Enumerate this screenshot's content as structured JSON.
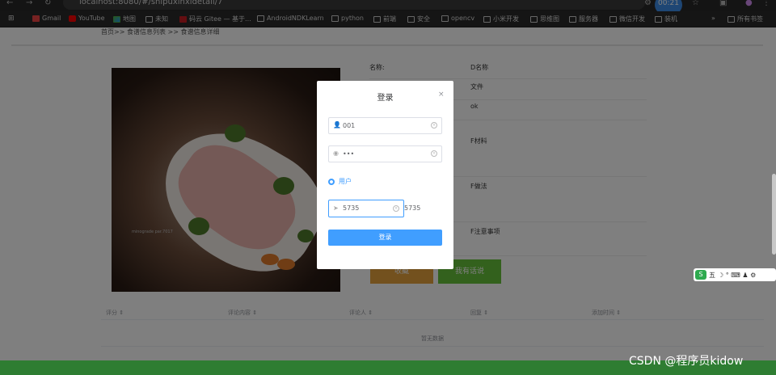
{
  "browser": {
    "url": "localhost:8080/#/shipuxinxidetail/7",
    "timer": "00:21",
    "bookmarks": [
      {
        "label": "Gmail",
        "icon": "gmail-icon"
      },
      {
        "label": "YouTube",
        "icon": "youtube-icon"
      },
      {
        "label": "地图",
        "icon": "maps-icon"
      },
      {
        "label": "未知",
        "icon": "folder-icon"
      },
      {
        "label": "码云 Gitee — 基于...",
        "icon": "gitee-icon"
      },
      {
        "label": "AndroidNDKLearn",
        "icon": "folder-icon"
      },
      {
        "label": "python",
        "icon": "folder-icon"
      },
      {
        "label": "前端",
        "icon": "folder-icon"
      },
      {
        "label": "安全",
        "icon": "folder-icon"
      },
      {
        "label": "opencv",
        "icon": "folder-icon"
      },
      {
        "label": "小米开发",
        "icon": "folder-icon"
      },
      {
        "label": "思维图",
        "icon": "folder-icon"
      },
      {
        "label": "服务器",
        "icon": "folder-icon"
      },
      {
        "label": "微信开发",
        "icon": "folder-icon"
      },
      {
        "label": "装机",
        "icon": "folder-icon"
      }
    ],
    "all_bookmarks": "所有书签",
    "more": "»"
  },
  "page": {
    "breadcrumb": "首页>> 食谱信息列表 >> 食谱信息详细",
    "info": [
      {
        "label": "名称:",
        "value": "D名称"
      },
      {
        "label": "",
        "value": "文件"
      },
      {
        "label": "",
        "value": "ok"
      },
      {
        "label": "",
        "value": "F材料"
      },
      {
        "label": "",
        "value": "F做法"
      },
      {
        "label": "",
        "value": "F注意事项"
      }
    ],
    "photo_caption": "minograde   par.7017",
    "fav_button": "收藏",
    "talk_button": "我有话说",
    "table": {
      "columns": [
        "评分 ⇕",
        "评论内容 ⇕",
        "评论人 ⇕",
        "回复 ⇕",
        "添加时间 ⇕"
      ],
      "empty": "暂无数据"
    }
  },
  "modal": {
    "title": "登录",
    "close": "×",
    "username": "001",
    "password": "•••",
    "role": "用户",
    "captcha_input": "5735",
    "captcha_code": "5735",
    "login_button": "登录"
  },
  "ime": {
    "label": "五",
    "icons": "☽ ° ⌨ ♟ ⚙"
  },
  "watermark": "CSDN @程序员kidow"
}
